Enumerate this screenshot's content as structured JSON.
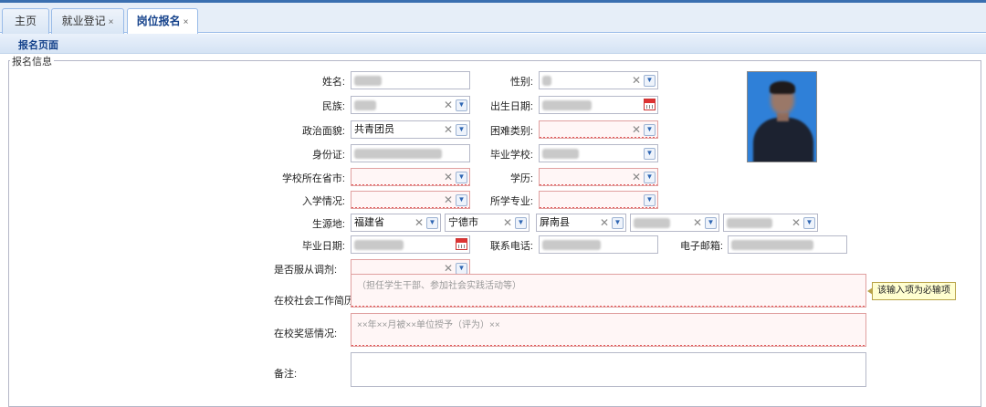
{
  "tabs": [
    {
      "label": "主页",
      "closable": false,
      "active": false
    },
    {
      "label": "就业登记",
      "closable": true,
      "active": false
    },
    {
      "label": "岗位报名",
      "closable": true,
      "active": true
    }
  ],
  "close_glyph": "×",
  "page_title": "报名页面",
  "section_legend": "报名信息",
  "form": {
    "name": {
      "label": "姓名:",
      "value": ""
    },
    "gender": {
      "label": "性别:",
      "value": ""
    },
    "ethnicity": {
      "label": "民族:",
      "value": ""
    },
    "birth_date": {
      "label": "出生日期:",
      "value": ""
    },
    "political_status": {
      "label": "政治面貌:",
      "value": "共青团员"
    },
    "hardship_type": {
      "label": "困难类别:",
      "value": ""
    },
    "id_card": {
      "label": "身份证:",
      "value": ""
    },
    "school": {
      "label": "毕业学校:",
      "value": ""
    },
    "school_province": {
      "label": "学校所在省市:",
      "value": ""
    },
    "education": {
      "label": "学历:",
      "value": ""
    },
    "enrollment": {
      "label": "入学情况:",
      "value": ""
    },
    "major": {
      "label": "所学专业:",
      "value": ""
    },
    "origin": {
      "label": "生源地:",
      "province": "福建省",
      "city": "宁德市",
      "county": "屏南县",
      "town": "",
      "village": ""
    },
    "graduation_date": {
      "label": "毕业日期:",
      "value": ""
    },
    "phone": {
      "label": "联系电话:",
      "value": ""
    },
    "email": {
      "label": "电子邮箱:",
      "value": ""
    },
    "accept_transfer": {
      "label": "是否服从调剂:",
      "value": ""
    },
    "work_history": {
      "label": "在校社会工作简历:",
      "placeholder": "（担任学生干部、参加社会实践活动等）"
    },
    "awards": {
      "label": "在校奖惩情况:",
      "placeholder": "××年××月被××单位授予（评为）××"
    },
    "remarks": {
      "label": "备注:",
      "value": ""
    }
  },
  "validation_tooltip": "该输入项为必输项",
  "icons": {
    "clear": "clear-icon",
    "dropdown": "chevron-down-icon",
    "calendar": "calendar-icon"
  },
  "colors": {
    "accent": "#15428b",
    "required_border": "#e0a0a0",
    "photo_bg": "#2f80d8"
  }
}
